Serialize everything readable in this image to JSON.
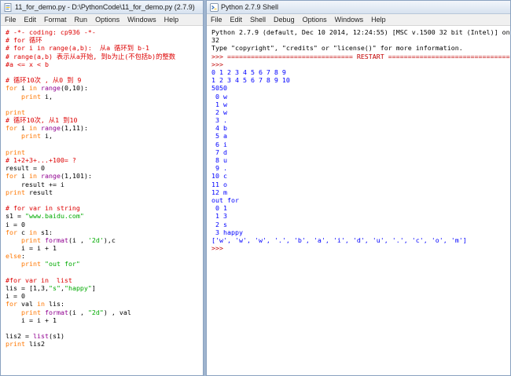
{
  "editor": {
    "title": "11_for_demo.py - D:\\PythonCode\\11_for_demo.py (2.7.9)",
    "menu": [
      "File",
      "Edit",
      "Format",
      "Run",
      "Options",
      "Windows",
      "Help"
    ],
    "lines": [
      [
        [
          "cmt",
          "# -*- coding: cp936 -*-"
        ]
      ],
      [
        [
          "cmt",
          "# for 循环"
        ]
      ],
      [
        [
          "cmt",
          "# for i in range(a,b):  从a 循环到 b-1"
        ]
      ],
      [
        [
          "cmt",
          "# range(a,b) 表示从a开始, 到b为止(不包括b)的整数"
        ]
      ],
      [
        [
          "cmt",
          "#a <= x < b"
        ]
      ],
      [],
      [
        [
          "cmt",
          "# 循环10次 , 从0 到 9"
        ]
      ],
      [
        [
          "kw",
          "for"
        ],
        [
          "",
          " i "
        ],
        [
          "kw",
          "in"
        ],
        [
          "",
          " "
        ],
        [
          "bi",
          "range"
        ],
        [
          "",
          "(0,10):"
        ]
      ],
      [
        [
          "",
          "    "
        ],
        [
          "kw",
          "print"
        ],
        [
          "",
          " i,"
        ]
      ],
      [],
      [
        [
          "kw",
          "print"
        ]
      ],
      [
        [
          "cmt",
          "# 循环10次, 从1 到10"
        ]
      ],
      [
        [
          "kw",
          "for"
        ],
        [
          "",
          " i "
        ],
        [
          "kw",
          "in"
        ],
        [
          "",
          " "
        ],
        [
          "bi",
          "range"
        ],
        [
          "",
          "(1,11):"
        ]
      ],
      [
        [
          "",
          "    "
        ],
        [
          "kw",
          "print"
        ],
        [
          "",
          " i,"
        ]
      ],
      [],
      [
        [
          "kw",
          "print"
        ]
      ],
      [
        [
          "cmt",
          "# 1+2+3+...+100= ?"
        ]
      ],
      [
        [
          "",
          "result = 0"
        ]
      ],
      [
        [
          "kw",
          "for"
        ],
        [
          "",
          " i "
        ],
        [
          "kw",
          "in"
        ],
        [
          "",
          " "
        ],
        [
          "bi",
          "range"
        ],
        [
          "",
          "(1,101):"
        ]
      ],
      [
        [
          "",
          "    result += i"
        ]
      ],
      [
        [
          "kw",
          "print"
        ],
        [
          "",
          " result"
        ]
      ],
      [],
      [
        [
          "cmt",
          "# for var in string"
        ]
      ],
      [
        [
          "",
          "s1 = "
        ],
        [
          "st",
          "\"www.baidu.com\""
        ]
      ],
      [
        [
          "",
          "i = 0"
        ]
      ],
      [
        [
          "kw",
          "for"
        ],
        [
          "",
          " c "
        ],
        [
          "kw",
          "in"
        ],
        [
          "",
          " s1:"
        ]
      ],
      [
        [
          "",
          "    "
        ],
        [
          "kw",
          "print"
        ],
        [
          "",
          " "
        ],
        [
          "bi",
          "format"
        ],
        [
          "",
          "(i , "
        ],
        [
          "st",
          "'2d'"
        ],
        [
          "",
          "),c"
        ]
      ],
      [
        [
          "",
          "    i = i + 1"
        ]
      ],
      [
        [
          "kw",
          "else"
        ],
        [
          "",
          ":"
        ]
      ],
      [
        [
          "",
          "    "
        ],
        [
          "kw",
          "print"
        ],
        [
          "",
          " "
        ],
        [
          "st",
          "\"out for\""
        ]
      ],
      [],
      [
        [
          "cmt",
          "#for var in  list"
        ]
      ],
      [
        [
          "",
          "lis = [1,3,"
        ],
        [
          "st",
          "\"s\""
        ],
        [
          "",
          ","
        ],
        [
          "st",
          "\"happy\""
        ],
        [
          "",
          "]"
        ]
      ],
      [
        [
          "",
          "i = 0"
        ]
      ],
      [
        [
          "kw",
          "for"
        ],
        [
          "",
          " val "
        ],
        [
          "kw",
          "in"
        ],
        [
          "",
          " lis:"
        ]
      ],
      [
        [
          "",
          "    "
        ],
        [
          "kw",
          "print"
        ],
        [
          "",
          " "
        ],
        [
          "bi",
          "format"
        ],
        [
          "",
          "(i , "
        ],
        [
          "st",
          "\"2d\""
        ],
        [
          "",
          ") , val"
        ]
      ],
      [
        [
          "",
          "    i = i + 1"
        ]
      ],
      [],
      [
        [
          "",
          "lis2 = "
        ],
        [
          "bi",
          "list"
        ],
        [
          "",
          "(s1)"
        ]
      ],
      [
        [
          "kw",
          "print"
        ],
        [
          "",
          " lis2"
        ]
      ]
    ]
  },
  "shell": {
    "title": "Python 2.7.9 Shell",
    "menu": [
      "File",
      "Edit",
      "Shell",
      "Debug",
      "Options",
      "Windows",
      "Help"
    ],
    "lines": [
      [
        [
          "hdr",
          "Python 2.7.9 (default, Dec 10 2014, 12:24:55) [MSC v.1500 32 bit (Intel)] on win"
        ]
      ],
      [
        [
          "hdr",
          "32"
        ]
      ],
      [
        [
          "hdr",
          "Type \"copyright\", \"credits\" or \"license()\" for more information."
        ]
      ],
      [
        [
          "pr",
          ">>> ================================ RESTART ================================"
        ]
      ],
      [
        [
          "pr",
          ">>> "
        ]
      ],
      [
        [
          "out",
          "0 1 2 3 4 5 6 7 8 9"
        ]
      ],
      [
        [
          "out",
          "1 2 3 4 5 6 7 8 9 10"
        ]
      ],
      [
        [
          "out",
          "5050"
        ]
      ],
      [
        [
          "out",
          " 0 w"
        ]
      ],
      [
        [
          "out",
          " 1 w"
        ]
      ],
      [
        [
          "out",
          " 2 w"
        ]
      ],
      [
        [
          "out",
          " 3 ."
        ]
      ],
      [
        [
          "out",
          " 4 b"
        ]
      ],
      [
        [
          "out",
          " 5 a"
        ]
      ],
      [
        [
          "out",
          " 6 i"
        ]
      ],
      [
        [
          "out",
          " 7 d"
        ]
      ],
      [
        [
          "out",
          " 8 u"
        ]
      ],
      [
        [
          "out",
          " 9 ."
        ]
      ],
      [
        [
          "out",
          "10 c"
        ]
      ],
      [
        [
          "out",
          "11 o"
        ]
      ],
      [
        [
          "out",
          "12 m"
        ]
      ],
      [
        [
          "out",
          "out for"
        ]
      ],
      [
        [
          "out",
          " 0 1"
        ]
      ],
      [
        [
          "out",
          " 1 3"
        ]
      ],
      [
        [
          "out",
          " 2 s"
        ]
      ],
      [
        [
          "out",
          " 3 happy"
        ]
      ],
      [
        [
          "out",
          "['w', 'w', 'w', '.', 'b', 'a', 'i', 'd', 'u', '.', 'c', 'o', 'm']"
        ]
      ],
      [
        [
          "pr",
          ">>> "
        ]
      ]
    ]
  },
  "colors": {
    "comment": "#dd0000",
    "keyword": "#ff7700",
    "builtin": "#900090",
    "string": "#00aa00",
    "output": "#0000ff",
    "prompt": "#c00000"
  },
  "icons": {
    "editor": "python-file-icon",
    "shell": "python-shell-icon"
  }
}
